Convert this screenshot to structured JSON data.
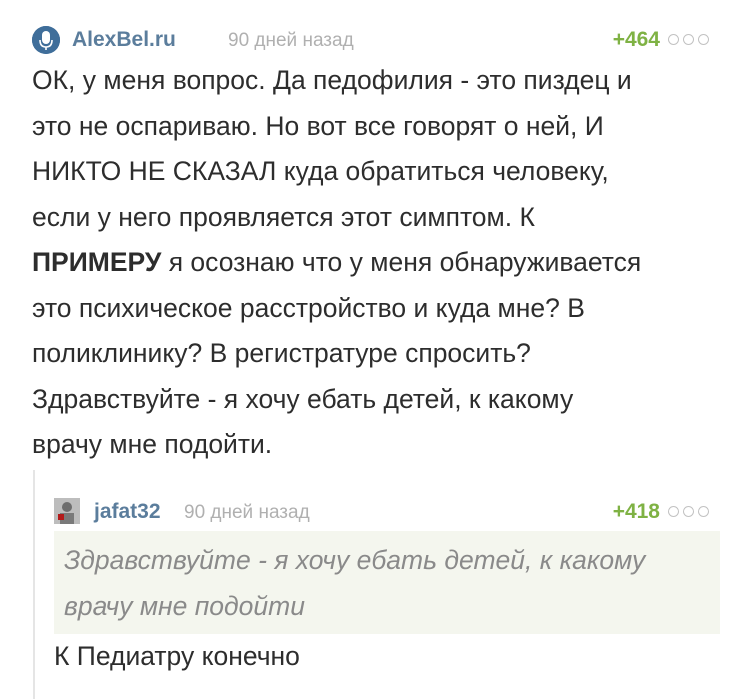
{
  "comment": {
    "author": "AlexBel.ru",
    "time": "90 дней назад",
    "rating": "+464",
    "lines": [
      "ОК, у меня вопрос. Да педофилия - это пиздец и",
      "это не оспариваю. Но вот все говорят о ней, И",
      "НИКТО НЕ СКАЗАЛ куда обратиться человеку,",
      "если у него проявляется этот симптом. К"
    ],
    "bold_word": "ПРИМЕРУ",
    "line5_rest": " я осознаю что у меня обнаруживается",
    "lines_after": [
      "это психическое расстройство и куда мне? В",
      "поликлинику? В регистратуре спросить?",
      "Здравствуйте - я хочу ебать детей, к какому",
      "врачу мне подойти."
    ]
  },
  "reply": {
    "author": "jafat32",
    "time": "90 дней назад",
    "rating": "+418",
    "quote_lines": [
      "Здравствуйте - я хочу ебать детей, к какому",
      "врачу мне подойти"
    ],
    "text": "К Педиатру конечно"
  },
  "icons": {
    "main_avatar": "microphone-avatar",
    "more": "more-dots-icon"
  },
  "colors": {
    "author": "#5b7d9c",
    "rating": "#7fb244",
    "muted": "#b0b0b0",
    "quote_bg": "#f4f6ee"
  }
}
